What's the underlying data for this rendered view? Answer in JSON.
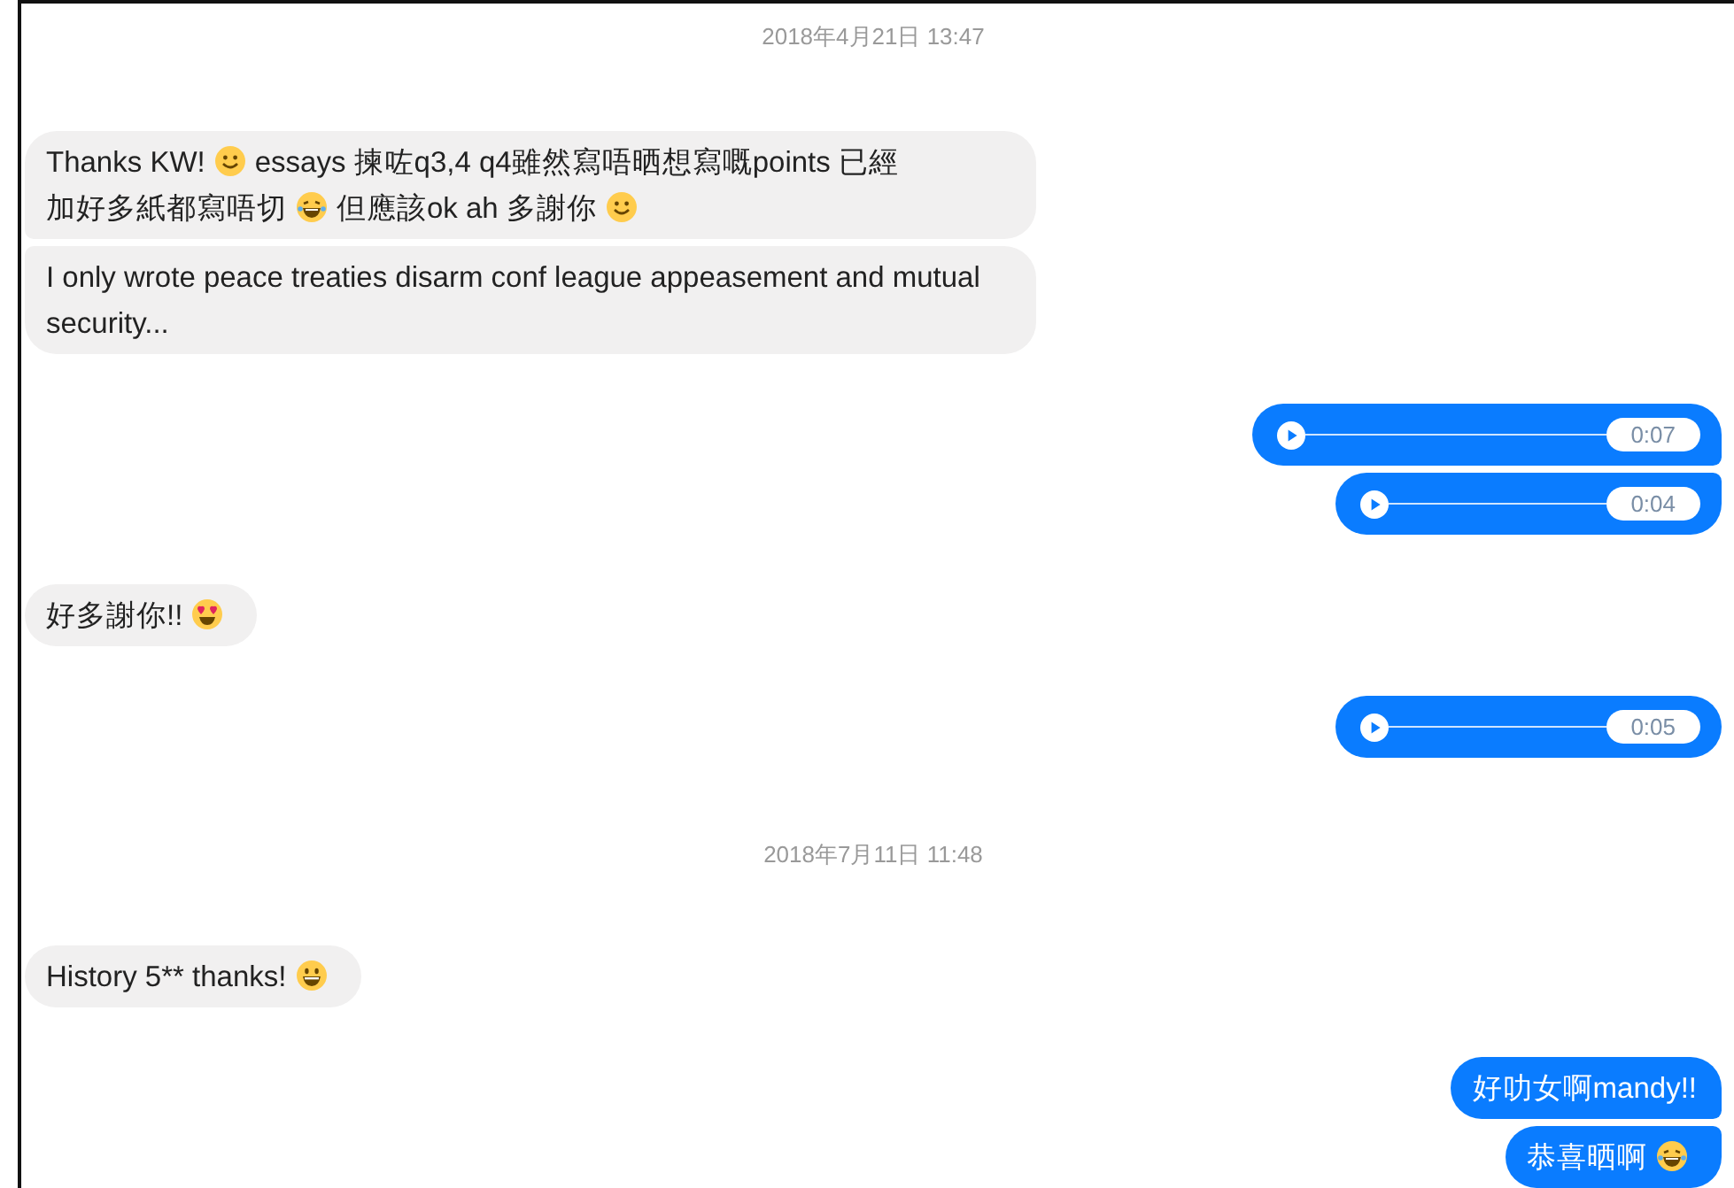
{
  "sections": [
    {
      "timestamp": "2018年4月21日 13:47",
      "groups": [
        {
          "kind": "incoming",
          "messages": [
            {
              "kind": "text",
              "parts": [
                {
                  "kind": "text",
                  "text": "Thanks KW!"
                },
                {
                  "kind": "smile"
                },
                {
                  "kind": "text",
                  "text": "essays 揀咗q3,4 q4雖然寫唔晒想寫嘅points 已經"
                },
                {
                  "kind": "text",
                  "text": "加好多紙都寫唔切"
                },
                {
                  "kind": "laugh"
                },
                {
                  "kind": "text",
                  "text": "但應該ok ah 多謝你"
                },
                {
                  "kind": "smile"
                }
              ]
            },
            {
              "kind": "text",
              "parts": [
                {
                  "kind": "text",
                  "text": "I only wrote peace treaties disarm conf league appeasement and mutual security..."
                }
              ]
            }
          ]
        },
        {
          "kind": "outgoing",
          "messages": [
            {
              "kind": "voice",
              "duration": "0:07"
            },
            {
              "kind": "voice",
              "duration": "0:04"
            }
          ]
        },
        {
          "kind": "incoming",
          "messages": [
            {
              "kind": "text",
              "parts": [
                {
                  "kind": "text",
                  "text": "好多謝你!!"
                },
                {
                  "kind": "hearts"
                }
              ]
            }
          ]
        },
        {
          "kind": "outgoing",
          "messages": [
            {
              "kind": "voice",
              "duration": "0:05"
            }
          ]
        }
      ]
    },
    {
      "timestamp": "2018年7月11日 11:48",
      "groups": [
        {
          "kind": "incoming",
          "messages": [
            {
              "kind": "text",
              "parts": [
                {
                  "kind": "text",
                  "text": "History 5** thanks!"
                },
                {
                  "kind": "grin"
                }
              ]
            }
          ]
        },
        {
          "kind": "outgoing",
          "messages": [
            {
              "kind": "text",
              "parts": [
                {
                  "kind": "text",
                  "text": "好叻女啊mandy!!"
                }
              ]
            },
            {
              "kind": "text",
              "parts": [
                {
                  "kind": "text",
                  "text": "恭喜晒啊"
                },
                {
                  "kind": "laugh"
                }
              ]
            }
          ]
        }
      ]
    }
  ]
}
